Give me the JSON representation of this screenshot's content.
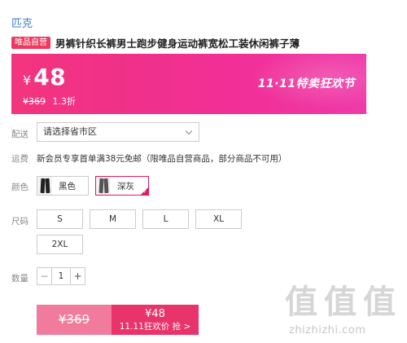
{
  "brand": "匹克",
  "badge": "唯品自营",
  "product_title": "男裤针织长裤男士跑步健身运动裤宽松工装休闲裤子薄",
  "price": {
    "currency": "¥",
    "current": "48",
    "original": "¥369",
    "discount": "1.3折",
    "promo": "11·11特卖狂欢节"
  },
  "labels": {
    "delivery": "配送",
    "shipping": "运费",
    "color": "颜色",
    "size": "尺码",
    "quantity": "数量"
  },
  "region_select": {
    "value": "请选择省市区"
  },
  "shipping_text": "新会员专享首单满38元免邮（限唯品自营商品，部分商品不可用）",
  "colors": [
    {
      "label": "黑色",
      "selected": false
    },
    {
      "label": "深灰",
      "selected": true
    }
  ],
  "sizes": [
    "S",
    "M",
    "L",
    "XL",
    "2XL"
  ],
  "quantity": {
    "minus": "−",
    "value": "1",
    "plus": "+"
  },
  "buy": {
    "original": "¥369",
    "price": "¥48",
    "cta": "11.11狂欢价 抢 >"
  },
  "watermark": {
    "glyph": "值",
    "url": "zhizhizhi.com"
  },
  "colors_theme": {
    "accent": "#e8336b",
    "brand_link": "#3d7fc2",
    "banner_start": "#f3347d",
    "banner_end": "#ee3aa8"
  }
}
